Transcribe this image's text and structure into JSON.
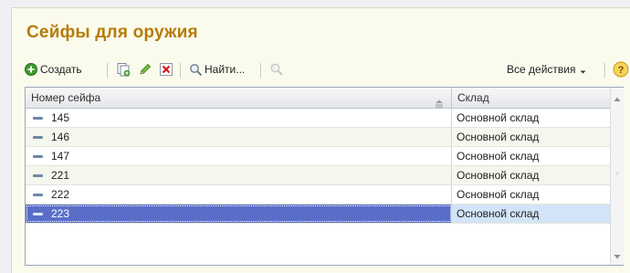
{
  "window": {
    "title": "Сейфы для оружия"
  },
  "toolbar": {
    "create_label": "Создать",
    "find_label": "Найти...",
    "all_actions_label": "Все действия",
    "help_label": "?"
  },
  "table": {
    "columns": [
      "Номер сейфа",
      "Склад"
    ],
    "rows": [
      {
        "number": "145",
        "warehouse": "Основной склад",
        "selected": false
      },
      {
        "number": "146",
        "warehouse": "Основной склад",
        "selected": false
      },
      {
        "number": "147",
        "warehouse": "Основной склад",
        "selected": false
      },
      {
        "number": "221",
        "warehouse": "Основной склад",
        "selected": false
      },
      {
        "number": "222",
        "warehouse": "Основной склад",
        "selected": false
      },
      {
        "number": "223",
        "warehouse": "Основной склад",
        "selected": true
      }
    ]
  },
  "colors": {
    "title": "#b57b07",
    "selection": "#5a6ec8",
    "create_icon": "#3d9a2e"
  },
  "icons": [
    "add-circle-icon",
    "copy-icon",
    "edit-pencil-icon",
    "delete-icon",
    "find-icon",
    "cancel-find-icon",
    "chevron-down-icon",
    "help-icon",
    "sort-icon",
    "scroll-up-icon",
    "scroll-down-icon",
    "row-dash-icon"
  ]
}
